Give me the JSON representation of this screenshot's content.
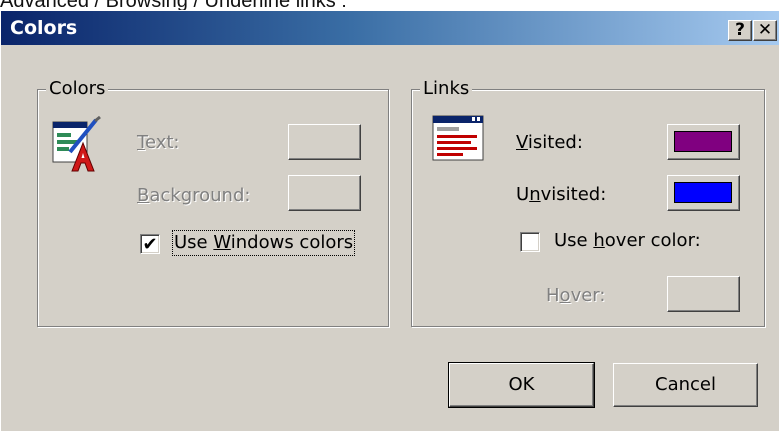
{
  "background_caption": "Advanced / Browsing / Underline links :",
  "window": {
    "title": "Colors",
    "help_button": "?",
    "close_button": "✕"
  },
  "colors_group": {
    "legend": "Colors",
    "icon": "text-color-palette-icon",
    "text_label_underlined": "T",
    "text_label_rest": "ext:",
    "background_label_underlined": "B",
    "background_label_rest": "ackground:",
    "use_windows_colors": {
      "checked": true,
      "check_mark": "✔",
      "label_before": "Use ",
      "label_underlined": "W",
      "label_after": "indows colors"
    }
  },
  "links_group": {
    "legend": "Links",
    "icon": "web-page-links-icon",
    "visited_label_underlined": "V",
    "visited_label_rest": "isited:",
    "visited_color": "#800080",
    "unvisited_label_before": "U",
    "unvisited_label_underlined": "n",
    "unvisited_label_rest": "visited:",
    "unvisited_color": "#0000ff",
    "use_hover": {
      "checked": false,
      "label_before": "Use ",
      "label_underlined": "h",
      "label_after": "over color:"
    },
    "hover_label_before": "H",
    "hover_label_underlined": "o",
    "hover_label_rest": "ver:"
  },
  "buttons": {
    "ok": "OK",
    "cancel": "Cancel"
  }
}
